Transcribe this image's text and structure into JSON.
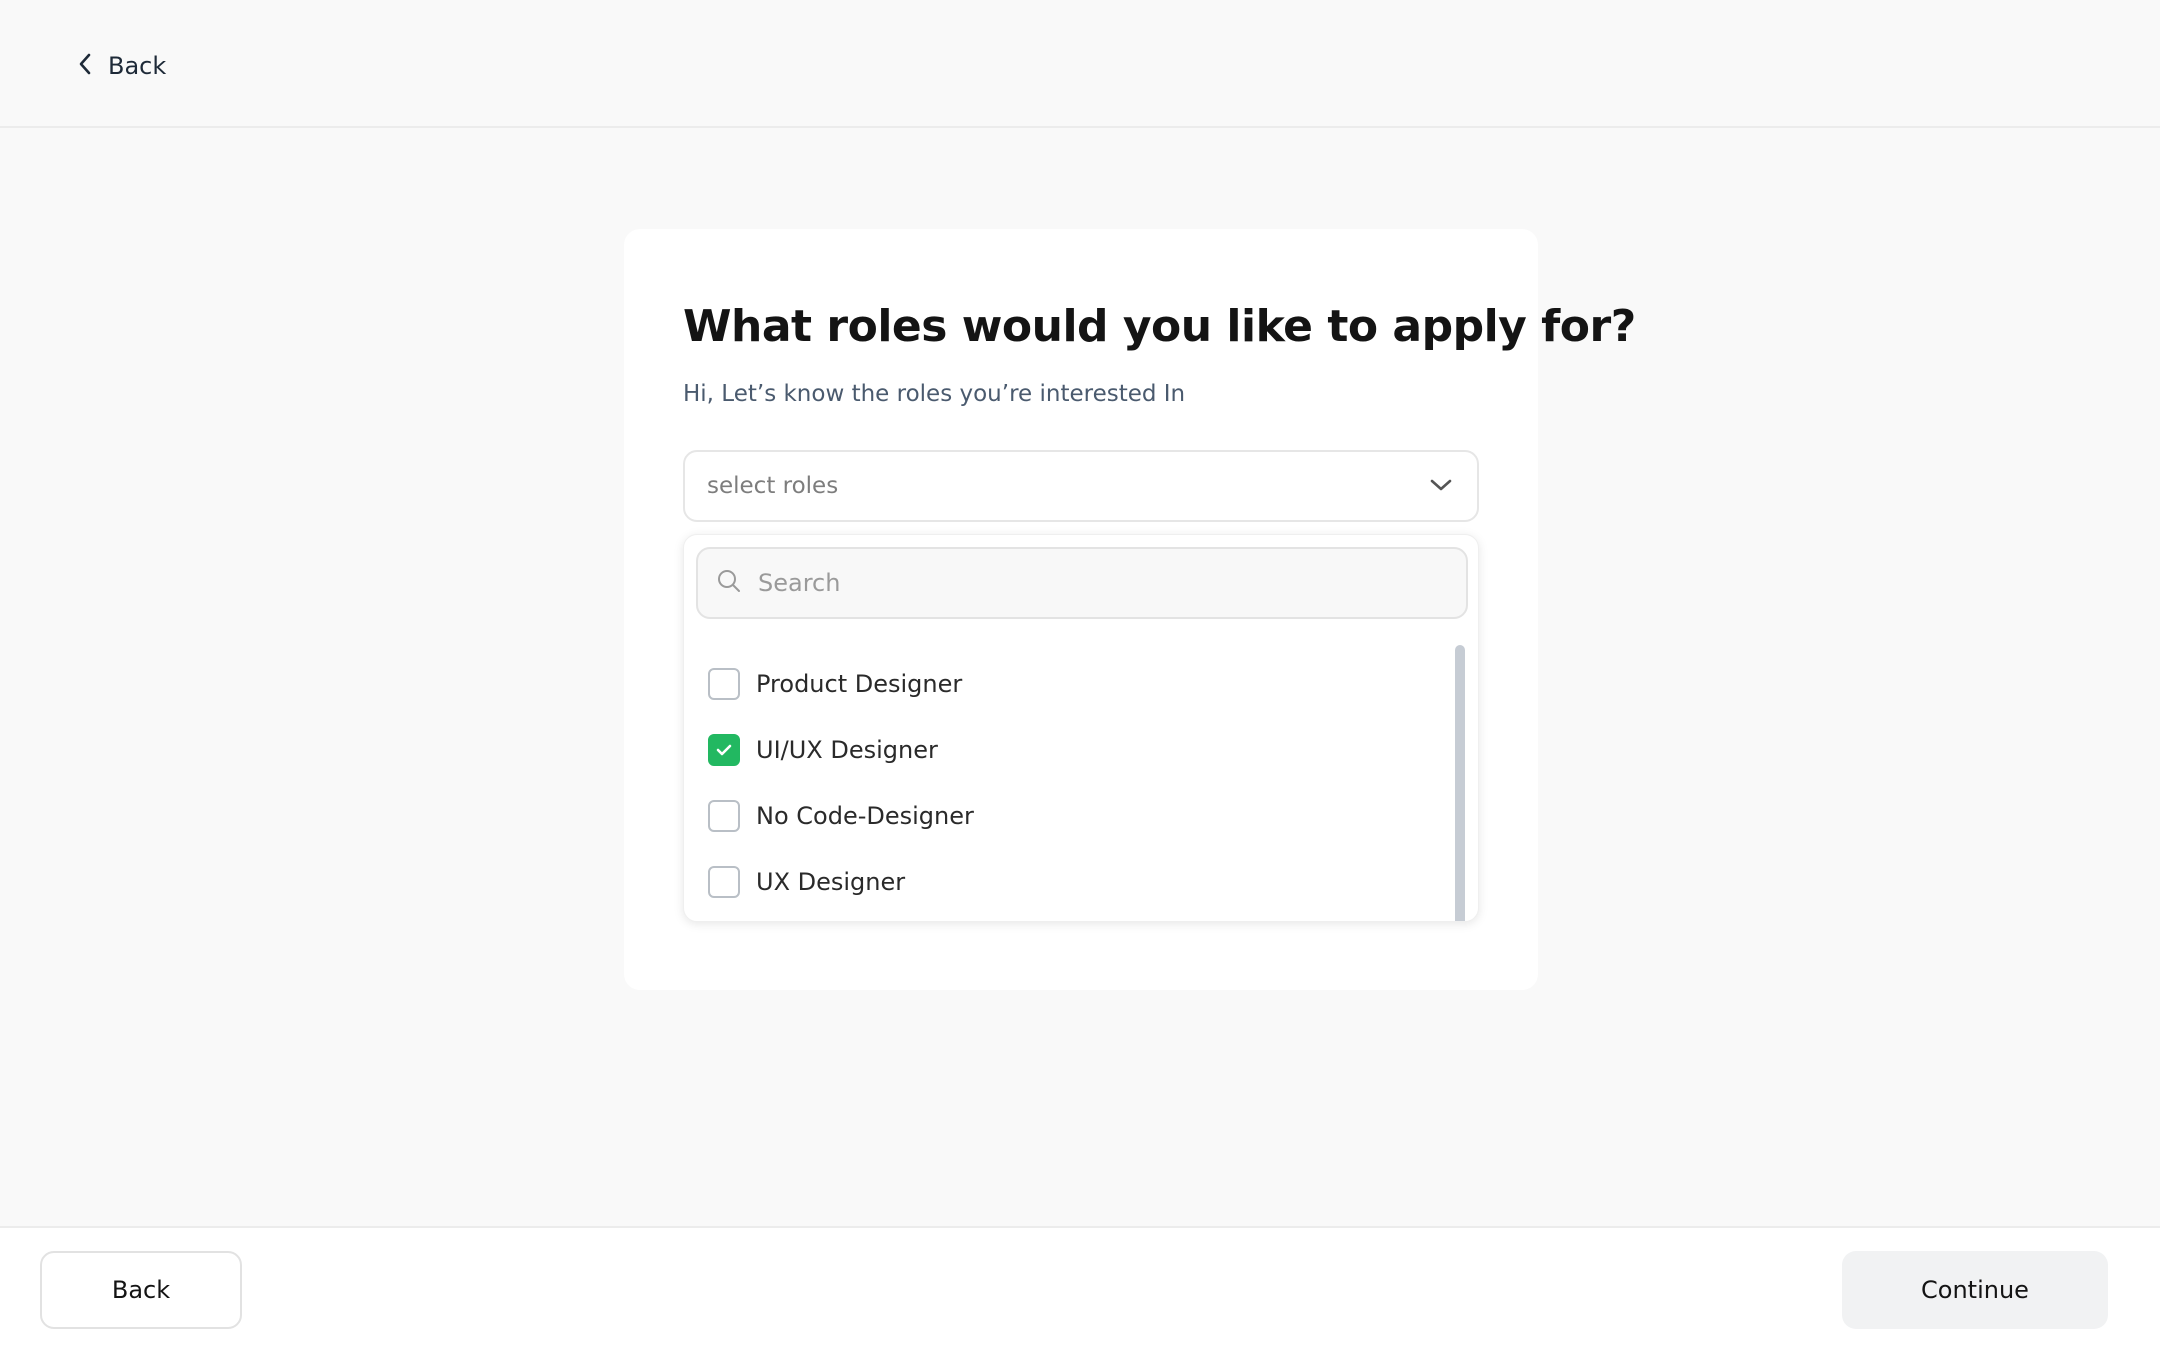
{
  "header": {
    "back_label": "Back"
  },
  "card": {
    "title": "What roles would you like to apply for?",
    "subtitle": "Hi, Let’s know the roles you’re interested In"
  },
  "select": {
    "placeholder": "select roles",
    "icon": "chevron-down-icon"
  },
  "dropdown": {
    "search_placeholder": "Search",
    "search_icon": "search-icon",
    "options": [
      {
        "label": "Product Designer",
        "checked": false
      },
      {
        "label": "UI/UX Designer",
        "checked": true
      },
      {
        "label": "No Code-Designer",
        "checked": false
      },
      {
        "label": "UX Designer",
        "checked": false
      }
    ]
  },
  "footer": {
    "back_label": "Back",
    "continue_label": "Continue"
  },
  "colors": {
    "accent_green": "#22b861",
    "background": "#f9f9f9",
    "card": "#ffffff",
    "subtitle_text": "#4a5a6e"
  }
}
